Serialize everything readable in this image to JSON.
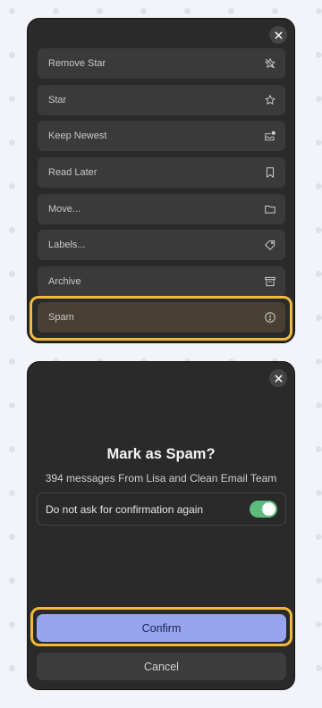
{
  "actions_menu": {
    "items": [
      {
        "label": "Remove Star",
        "icon": "star-off-icon"
      },
      {
        "label": "Star",
        "icon": "star-icon"
      },
      {
        "label": "Keep Newest",
        "icon": "keep-newest-icon"
      },
      {
        "label": "Read Later",
        "icon": "bookmark-icon"
      },
      {
        "label": "Move...",
        "icon": "folder-icon"
      },
      {
        "label": "Labels...",
        "icon": "label-tag-icon"
      },
      {
        "label": "Archive",
        "icon": "archive-icon"
      },
      {
        "label": "Spam",
        "icon": "spam-alert-icon",
        "highlighted": true
      }
    ],
    "close_icon": "close-icon"
  },
  "confirm_dialog": {
    "title": "Mark as Spam?",
    "subtitle": "394 messages From Lisa and Clean Email Team",
    "toggle_label": "Do not ask for confirmation again",
    "toggle_on": true,
    "confirm_label": "Confirm",
    "cancel_label": "Cancel",
    "close_icon": "close-icon"
  },
  "colors": {
    "panel_bg": "#2a2a2a",
    "item_bg": "#3a3a3a",
    "highlight": "#f0b93c",
    "confirm_bg": "#97a5ee",
    "toggle_on": "#5dbd7d"
  }
}
